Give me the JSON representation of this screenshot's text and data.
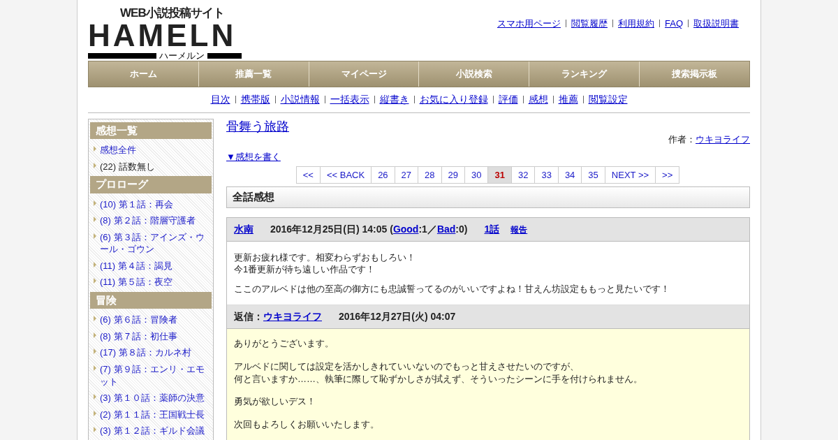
{
  "logo": {
    "tagline": "WEB小説投稿サイト",
    "wordmark": "HAMELN",
    "kana": "ハーメルン"
  },
  "top_links": [
    "スマホ用ページ",
    "閲覧履歴",
    "利用規約",
    "FAQ",
    "取扱説明書"
  ],
  "main_nav": [
    "ホーム",
    "推薦一覧",
    "マイページ",
    "小説検索",
    "ランキング",
    "捜索掲示板"
  ],
  "sub_nav": [
    "目次",
    "携帯版",
    "小説情報",
    "一括表示",
    "縦書き",
    "お気に入り登録",
    "評価",
    "感想",
    "推薦",
    "閲覧設定"
  ],
  "sidebar": {
    "sections": [
      {
        "heading": "感想一覧",
        "items": [
          {
            "text": "感想全件",
            "link": true
          },
          {
            "text": "(22) 話数無し",
            "link": false
          }
        ]
      },
      {
        "heading": "プロローグ",
        "items": [
          {
            "text": "(10) 第１話：再会",
            "link": true
          },
          {
            "text": "(8) 第２話：階層守護者",
            "link": true
          },
          {
            "text": "(6) 第３話：アインズ・ウール・ゴウン",
            "link": true
          },
          {
            "text": "(11) 第４話：謁見",
            "link": true
          },
          {
            "text": "(11) 第５話：夜空",
            "link": true
          }
        ]
      },
      {
        "heading": "冒険",
        "items": [
          {
            "text": "(6) 第６話：冒険者",
            "link": true
          },
          {
            "text": "(8) 第７話：初仕事",
            "link": true
          },
          {
            "text": "(17) 第８話：カルネ村",
            "link": true
          },
          {
            "text": "(7) 第９話：エンリ・エモット",
            "link": true
          },
          {
            "text": "(3) 第１０話：薬師の決意",
            "link": true
          },
          {
            "text": "(2) 第１１話：王国戦士長",
            "link": true
          },
          {
            "text": "(3) 第１２話：ギルド会議",
            "link": true
          }
        ]
      }
    ]
  },
  "novel": {
    "title": "骨舞う旅路",
    "author_label": "作者：",
    "author": "ウキヨライフ",
    "write_link": "▼感想を書く"
  },
  "pagination": [
    {
      "label": "<<",
      "selected": false
    },
    {
      "label": "<< BACK",
      "selected": false
    },
    {
      "label": "26",
      "selected": false
    },
    {
      "label": "27",
      "selected": false
    },
    {
      "label": "28",
      "selected": false
    },
    {
      "label": "29",
      "selected": false
    },
    {
      "label": "30",
      "selected": false
    },
    {
      "label": "31",
      "selected": true
    },
    {
      "label": "32",
      "selected": false
    },
    {
      "label": "33",
      "selected": false
    },
    {
      "label": "34",
      "selected": false
    },
    {
      "label": "35",
      "selected": false
    },
    {
      "label": "NEXT >>",
      "selected": false
    },
    {
      "label": ">>",
      "selected": false
    }
  ],
  "section_title": "全話感想",
  "comments": [
    {
      "author": "水南",
      "date": "2016年12月25日(日) 14:05 (",
      "good_link": "Good",
      "good_count": ":1／",
      "bad_link": "Bad",
      "bad_count": ":0)",
      "episode_link": "1話",
      "report_link": "報告",
      "paragraphs": [
        [
          "更新お疲れ様です。相変わらずおもしろい！",
          "今1番更新が待ち遠しい作品です！"
        ],
        [
          "ここのアルベドは他の至高の御方にも忠誠誓ってるのがいいですよね！甘えん坊設定ももっと見たいです！"
        ]
      ],
      "reply": {
        "label": "返信：",
        "author": "ウキヨライフ",
        "date": "2016年12月27日(火) 04:07",
        "paragraphs": [
          [
            "ありがとうございます。"
          ],
          [
            "アルベドに関しては設定を活かしきれていいないのでもっと甘えさせたいのですが、",
            "何と言いますか……、執筆に際して恥ずかしさが拭えず、そういったシーンに手を付けられません。"
          ],
          [
            "勇気が欲しいデス！"
          ],
          [
            "次回もよろしくお願いいたします。"
          ]
        ]
      }
    }
  ]
}
